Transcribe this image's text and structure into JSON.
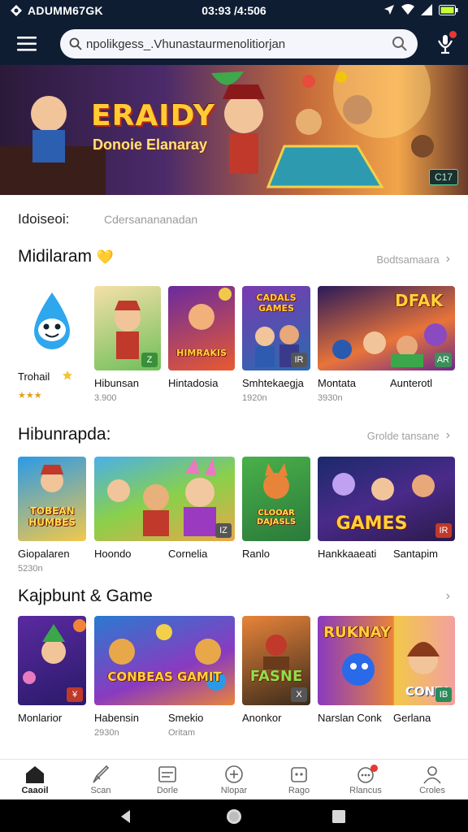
{
  "status_bar": {
    "carrier": "ADUMM67GK",
    "time": "03:93 /4:506",
    "icons": [
      "location-icon",
      "wifi-icon",
      "signal-icon",
      "battery-icon"
    ]
  },
  "search": {
    "value": "npolikgess_.Vhunastaurmenolitiorjan"
  },
  "banner": {
    "title": "ERAIDY",
    "subtitle": "Donoie Elanaray",
    "badge": "C17"
  },
  "filter": {
    "label": "Idoiseoi:",
    "value": "Cdersanananadan"
  },
  "sections": [
    {
      "title": "Midilaram",
      "title_badge": "💛",
      "see_all": "Bodtsamaara",
      "items": [
        {
          "name": "Trohail",
          "sub": "★★★",
          "art": "water-drop mascot",
          "badge": ""
        },
        {
          "name": "Hibunsan",
          "sub": "3.900",
          "art": "",
          "badge": "Z"
        },
        {
          "name": "Hintadosia",
          "sub": "",
          "art": "HIMRAKIS",
          "badge": ""
        },
        {
          "name": "Smhtekaegja",
          "sub": "1920n",
          "art": "CADALS GAMES",
          "badge": "IR"
        },
        {
          "name": "Montata",
          "sub": "3930n",
          "art": "DFAK",
          "badge": ""
        },
        {
          "name": "Aunterotl",
          "sub": "",
          "art": "",
          "badge": "AR"
        }
      ]
    },
    {
      "title": "Hibunrapda:",
      "title_badge": "",
      "see_all": "Grolde tansane",
      "items": [
        {
          "name": "Giopalaren",
          "sub": "5230n",
          "art": "TOBEAN HUMBES",
          "badge": ""
        },
        {
          "name": "Hoondo",
          "sub": "",
          "art": "",
          "badge": ""
        },
        {
          "name": "Cornelia",
          "sub": "",
          "art": "",
          "badge": "IZ"
        },
        {
          "name": "Ranlo",
          "sub": "",
          "art": "CLOOAR DAJASLS",
          "badge": ""
        },
        {
          "name": "Hankkaaeati",
          "sub": "",
          "art": "GAMES",
          "badge": ""
        },
        {
          "name": "Santapim",
          "sub": "",
          "art": "",
          "badge": "IR"
        }
      ]
    },
    {
      "title": "Kajpbunt & Game",
      "title_badge": "",
      "see_all": "",
      "items": [
        {
          "name": "Monlarior",
          "sub": "",
          "art": "",
          "badge": "¥"
        },
        {
          "name": "Habensin",
          "sub": "2930n",
          "art": "CONBEAS GAMIT",
          "badge": ""
        },
        {
          "name": "Smekio",
          "sub": "Oritam",
          "art": "",
          "badge": ""
        },
        {
          "name": "Anonkor",
          "sub": "",
          "art": "FASNE",
          "badge": "X"
        },
        {
          "name": "Narslan Conk",
          "sub": "",
          "art": "RUKNAY",
          "badge": ""
        },
        {
          "name": "Gerlana",
          "sub": "",
          "art": "CONBI",
          "badge": "IB"
        }
      ]
    }
  ],
  "bottom_nav": [
    {
      "label": "Caaoil",
      "icon": "home-icon",
      "active": true
    },
    {
      "label": "Scan",
      "icon": "rocket-icon",
      "active": false
    },
    {
      "label": "Dorle",
      "icon": "list-icon",
      "active": false
    },
    {
      "label": "Nlopar",
      "icon": "plus-circle-icon",
      "active": false
    },
    {
      "label": "Rago",
      "icon": "gamepad-icon",
      "active": false
    },
    {
      "label": "Rlancus",
      "icon": "bubble-icon",
      "active": false,
      "notification": true
    },
    {
      "label": "Croles",
      "icon": "user-icon",
      "active": false
    }
  ],
  "system_nav": [
    "back-icon",
    "home-circle-icon",
    "recents-icon"
  ]
}
